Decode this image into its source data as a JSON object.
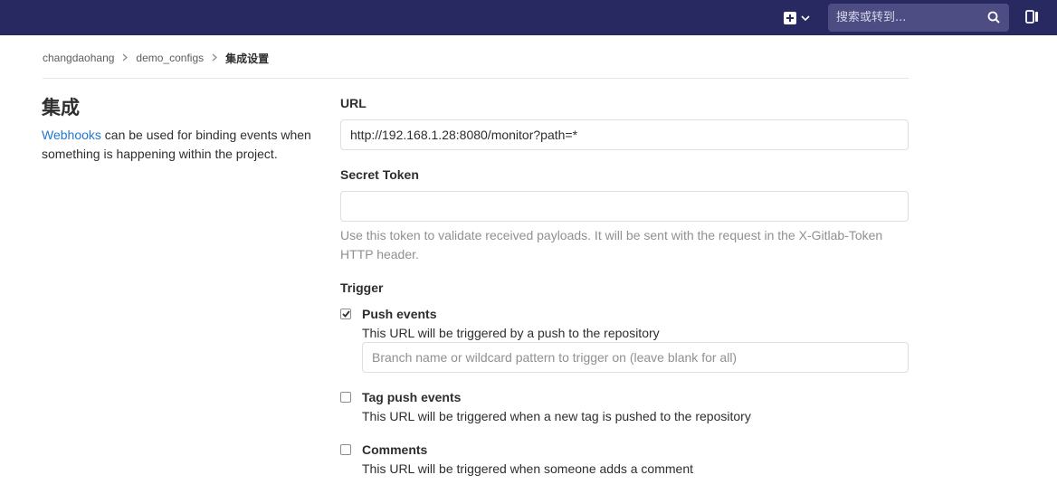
{
  "header": {
    "search_placeholder": "搜索或转到..."
  },
  "breadcrumb": {
    "items": [
      "changdaohang",
      "demo_configs"
    ],
    "current": "集成设置"
  },
  "sidebar": {
    "title": "集成",
    "link_text": "Webhooks",
    "description": " can be used for binding events when something is happening within the project."
  },
  "form": {
    "url_label": "URL",
    "url_value": "http://192.168.1.28:8080/monitor?path=*",
    "secret_label": "Secret Token",
    "secret_value": "",
    "secret_help": "Use this token to validate received payloads. It will be sent with the request in the X-Gitlab-Token HTTP header.",
    "trigger_label": "Trigger",
    "triggers": [
      {
        "title": "Push events",
        "checked": true,
        "help": "This URL will be triggered by a push to the repository",
        "branch_placeholder": "Branch name or wildcard pattern to trigger on (leave blank for all)"
      },
      {
        "title": "Tag push events",
        "checked": false,
        "help": "This URL will be triggered when a new tag is pushed to the repository"
      },
      {
        "title": "Comments",
        "checked": false,
        "help": "This URL will be triggered when someone adds a comment"
      }
    ]
  },
  "icons": {
    "new": "plus-square-icon",
    "dropdown": "chevron-down-icon",
    "search": "search-icon",
    "todo": "todo-icon",
    "breadcrumb_separator": "chevron-right-icon",
    "checked": "checkmark-icon"
  },
  "colors": {
    "topbar": "#292961",
    "search_bg": "#4d4d84",
    "link": "#1f78d1"
  }
}
